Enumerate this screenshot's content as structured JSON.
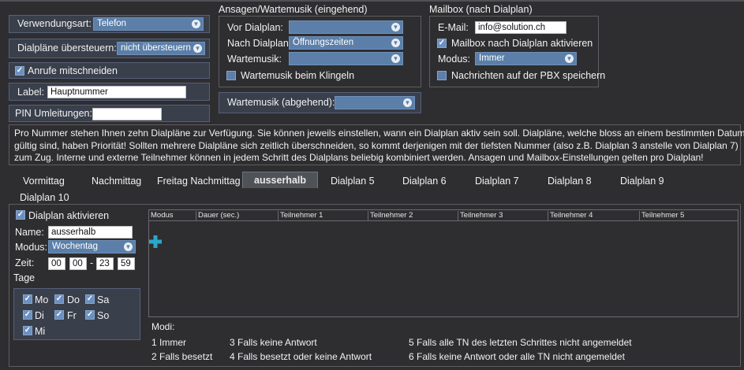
{
  "general": {
    "verwendungsart_label": "Verwendungsart:",
    "verwendungsart_value": "Telefon",
    "dialplaene_label": "Dialpläne übersteuern:",
    "dialplaene_value": "nicht übersteuern",
    "anrufe_label": "Anrufe mitschneiden",
    "label_label": "Label:",
    "label_value": "Hauptnummer",
    "pin_label": "PIN Umleitungen:",
    "pin_value": ""
  },
  "ansagen": {
    "title": "Ansagen/Wartemusik (eingehend)",
    "vor_label": "Vor Dialplan:",
    "vor_value": "",
    "nach_label": "Nach Dialplan:",
    "nach_value": "Öffnungszeiten",
    "wartemusik_label": "Wartemusik:",
    "wartemusik_value": "",
    "klingeln_label": "Wartemusik beim Klingeln",
    "abgehend_label": "Wartemusik (abgehend):",
    "abgehend_value": ""
  },
  "mailbox": {
    "title": "Mailbox (nach Dialplan)",
    "email_label": "E-Mail:",
    "email_value": "info@solution.ch",
    "aktivieren_label": "Mailbox nach Dialplan aktivieren",
    "modus_label": "Modus:",
    "modus_value": "Immer",
    "pbx_label": "Nachrichten auf der PBX speichern"
  },
  "info": {
    "line1": "Pro Nummer stehen Ihnen zehn Dialpläne zur Verfügung. Sie können jeweils einstellen, wann ein Dialplan aktiv sein soll. Dialpläne, welche bloss an einem bestimmten Datum",
    "line2": "gültig sind, haben Priorität! Sollten mehrere Dialpläne sich zeitlich überschneiden, so kommt derjenigen mit der tiefsten Nummer (also z.B. Dialplan 3 anstelle von Dialplan 7)",
    "line3": "zum Zug. Interne und externe Teilnehmer können in jedem Schritt des Dialplans beliebig kombiniert werden. Ansagen und Mailbox-Einstellungen gelten pro Dialplan!"
  },
  "tabs": [
    "Vormittag",
    "Nachmittag",
    "Freitag Nachmittag",
    "ausserhalb",
    "Dialplan 5",
    "Dialplan 6",
    "Dialplan 7",
    "Dialplan 8",
    "Dialplan 9",
    "Dialplan 10"
  ],
  "active_tab": "ausserhalb",
  "plan": {
    "aktivieren_label": "Dialplan aktivieren",
    "name_label": "Name:",
    "name_value": "ausserhalb",
    "modus_label": "Modus:",
    "modus_value": "Wochentag",
    "zeit_label": "Zeit:",
    "from_h": "00",
    "from_m": "00",
    "dash": "-",
    "to_h": "23",
    "to_m": "59",
    "tage_label": "Tage",
    "days": {
      "mo": "Mo",
      "do": "Do",
      "sa": "Sa",
      "di": "Di",
      "fr": "Fr",
      "so": "So",
      "mi": "Mi"
    }
  },
  "table": {
    "headers": [
      "Modus",
      "Dauer (sec.)",
      "Teilnehmer 1",
      "Teilnehmer 2",
      "Teilnehmer 3",
      "Teilnehmer 4",
      "Teilnehmer 5"
    ],
    "add_icon": "plus-icon"
  },
  "modi": {
    "title": "Modi:",
    "items": [
      "1  Immer",
      "2  Falls besetzt",
      "3  Falls keine Antwort",
      "4  Falls besetzt oder keine Antwort",
      "5  Falls alle TN des letzten Schrittes nicht angemeldet",
      "6  Falls keine Antwort oder alle TN nicht angemeldet"
    ]
  },
  "colors": {
    "accent": "#5b7fa8",
    "panel": "#393f4b",
    "background": "#2e2e31",
    "add_icon": "#2aa7c9"
  }
}
